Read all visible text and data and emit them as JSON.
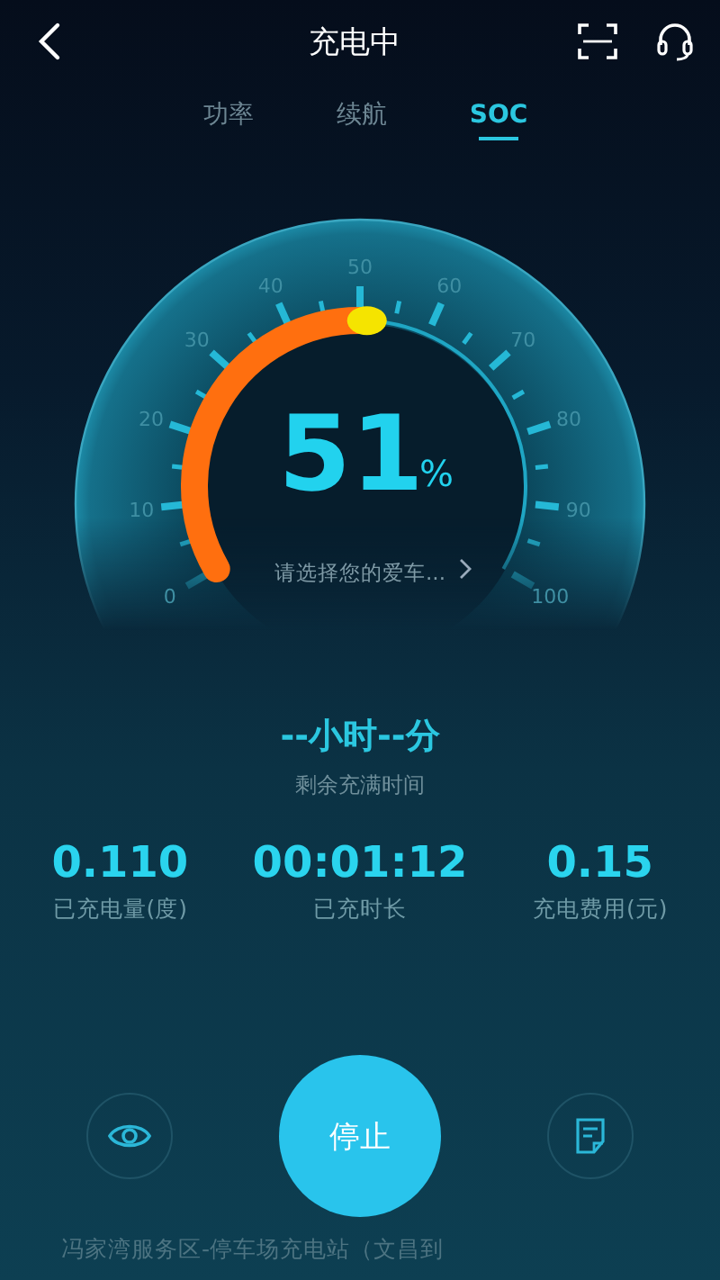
{
  "header": {
    "title": "充电中"
  },
  "tabs": [
    {
      "label": "功率",
      "selected": false
    },
    {
      "label": "续航",
      "selected": false
    },
    {
      "label": "SOC",
      "selected": true
    }
  ],
  "gauge": {
    "value": "51",
    "unit": "%",
    "scale_labels": [
      "0",
      "10",
      "20",
      "30",
      "40",
      "50",
      "60",
      "70",
      "80",
      "90",
      "100"
    ],
    "car_prompt": "请选择您的爱车..."
  },
  "remaining": {
    "value": "--小时--分",
    "label": "剩余充满时间"
  },
  "stats": [
    {
      "value": "0.110",
      "label": "已充电量(度)"
    },
    {
      "value": "00:01:12",
      "label": "已充时长"
    },
    {
      "value": "0.15",
      "label": "充电费用(元)"
    }
  ],
  "stop_button": "停止",
  "station": "冯家湾服务区-停车场充电站（文昌到"
}
